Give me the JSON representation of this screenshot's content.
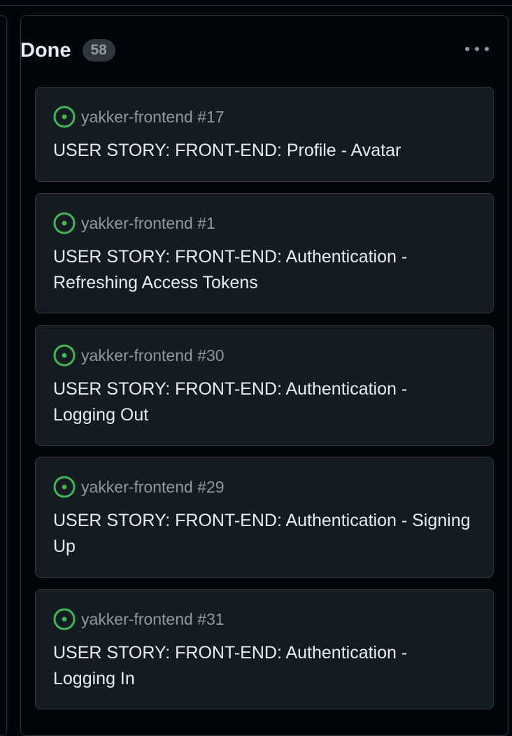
{
  "column": {
    "title": "Done",
    "count": "58",
    "menu_icon": "kebab-horizontal-icon"
  },
  "colors": {
    "background": "#010409",
    "card_background": "#151b23",
    "border": "#30363d",
    "open_issue_green": "#3fb950",
    "text_primary": "#e6edf3",
    "text_muted": "#9198a1"
  },
  "cards": [
    {
      "status_icon": "issue-opened-icon",
      "repo": "yakker-frontend #17",
      "title": "USER STORY: FRONT-END: Profile - Avatar"
    },
    {
      "status_icon": "issue-opened-icon",
      "repo": "yakker-frontend #1",
      "title": "USER STORY: FRONT-END: Authentication - Refreshing Access Tokens"
    },
    {
      "status_icon": "issue-opened-icon",
      "repo": "yakker-frontend #30",
      "title": "USER STORY: FRONT-END: Authentication - Logging Out"
    },
    {
      "status_icon": "issue-opened-icon",
      "repo": "yakker-frontend #29",
      "title": "USER STORY: FRONT-END: Authentication - Signing Up"
    },
    {
      "status_icon": "issue-opened-icon",
      "repo": "yakker-frontend #31",
      "title": "USER STORY: FRONT-END: Authentication - Logging In"
    }
  ]
}
